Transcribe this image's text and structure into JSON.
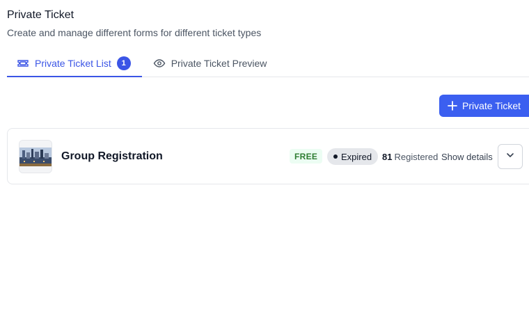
{
  "header": {
    "title": "Private Ticket",
    "subtitle": "Create and manage different forms for different ticket types"
  },
  "tabs": [
    {
      "label": "Private Ticket List",
      "icon": "ticket-icon",
      "badge": "1",
      "active": true
    },
    {
      "label": "Private Ticket Preview",
      "icon": "eye-icon",
      "active": false
    }
  ],
  "actions": {
    "add_label": "Private Ticket",
    "add_icon": "plus-icon"
  },
  "tickets": [
    {
      "name": "Group Registration",
      "price": "FREE",
      "status": "Expired",
      "registered_count": "81",
      "registered_label": "Registered",
      "details_label": "Show details",
      "thumbnail_icon": "event-image"
    }
  ],
  "colors": {
    "accent": "#3b55e6",
    "button": "#3b5ff0",
    "free_bg": "#ecfdf3",
    "free_text": "#2e7d32",
    "status_bg": "#e5e7eb"
  }
}
